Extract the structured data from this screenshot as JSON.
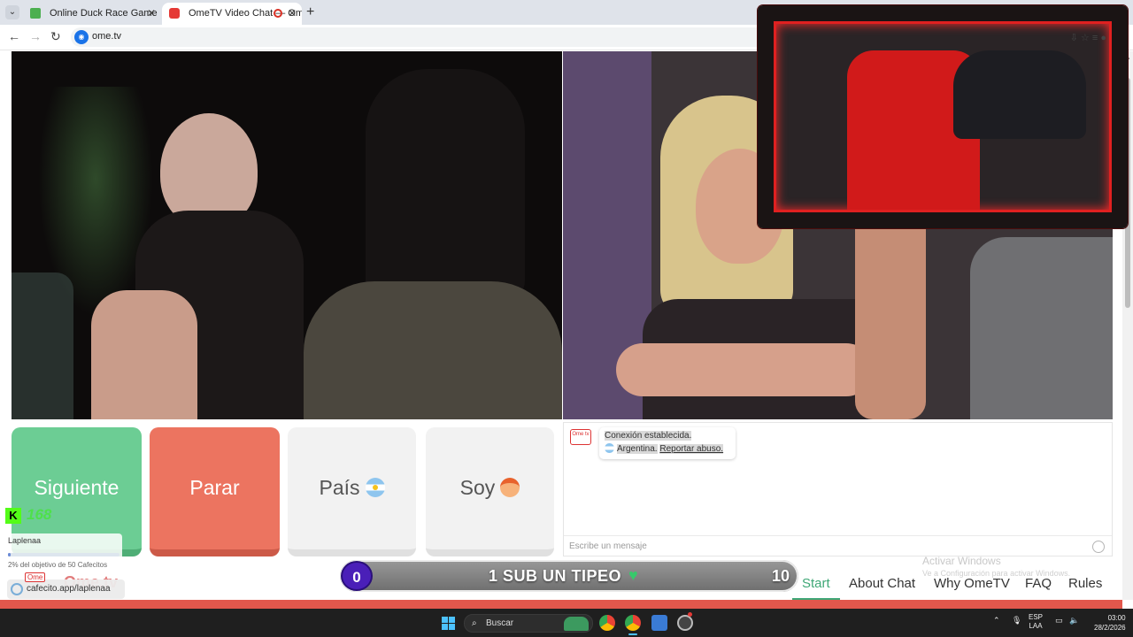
{
  "browser": {
    "tabs": [
      {
        "label": "Online Duck Race Game",
        "active": false
      },
      {
        "label": "OmeTV Video Chat — Ome",
        "active": true
      }
    ],
    "url": "ome.tv"
  },
  "controls": {
    "next_label": "Siguiente",
    "stop_label": "Parar",
    "country_label": "País",
    "iam_label": "Soy"
  },
  "chat": {
    "logo_text": "Ome tv",
    "connection_message": "Conexión establecida.",
    "country": "Argentina.",
    "report_link": "Reportar abuso.",
    "input_placeholder": "Escribe un mensaje"
  },
  "footer_nav": {
    "items": [
      "Start",
      "About Chat",
      "Why OmeTV",
      "FAQ",
      "Rules"
    ],
    "active": "Start"
  },
  "windows_watermark": {
    "line1": "Activar Windows",
    "line2": "Ve a Configuración para activar Windows."
  },
  "stream_overlay": {
    "follower_count": "168",
    "goal_name": "Laplenaa",
    "goal_text": "2% del objetivo de 50 Cafecitos",
    "goal_progress": 2,
    "cafecito_link": "cafecito.app/laplenaa",
    "ome_mini": "Ome",
    "ome_brand": "Ome.tv",
    "sub_banner": {
      "left_count": "0",
      "title": "1 SUB UN TIPEO",
      "right_count": "10"
    }
  },
  "taskbar": {
    "search_placeholder": "Buscar",
    "language_top": "ESP",
    "language_bottom": "LAA",
    "time": "03:00",
    "date": "28/2/2026"
  },
  "colors": {
    "next_button": "#6ccd94",
    "stop_button": "#ec7460",
    "nav_active": "#3fa776",
    "overlay_glow": "#e02020"
  }
}
